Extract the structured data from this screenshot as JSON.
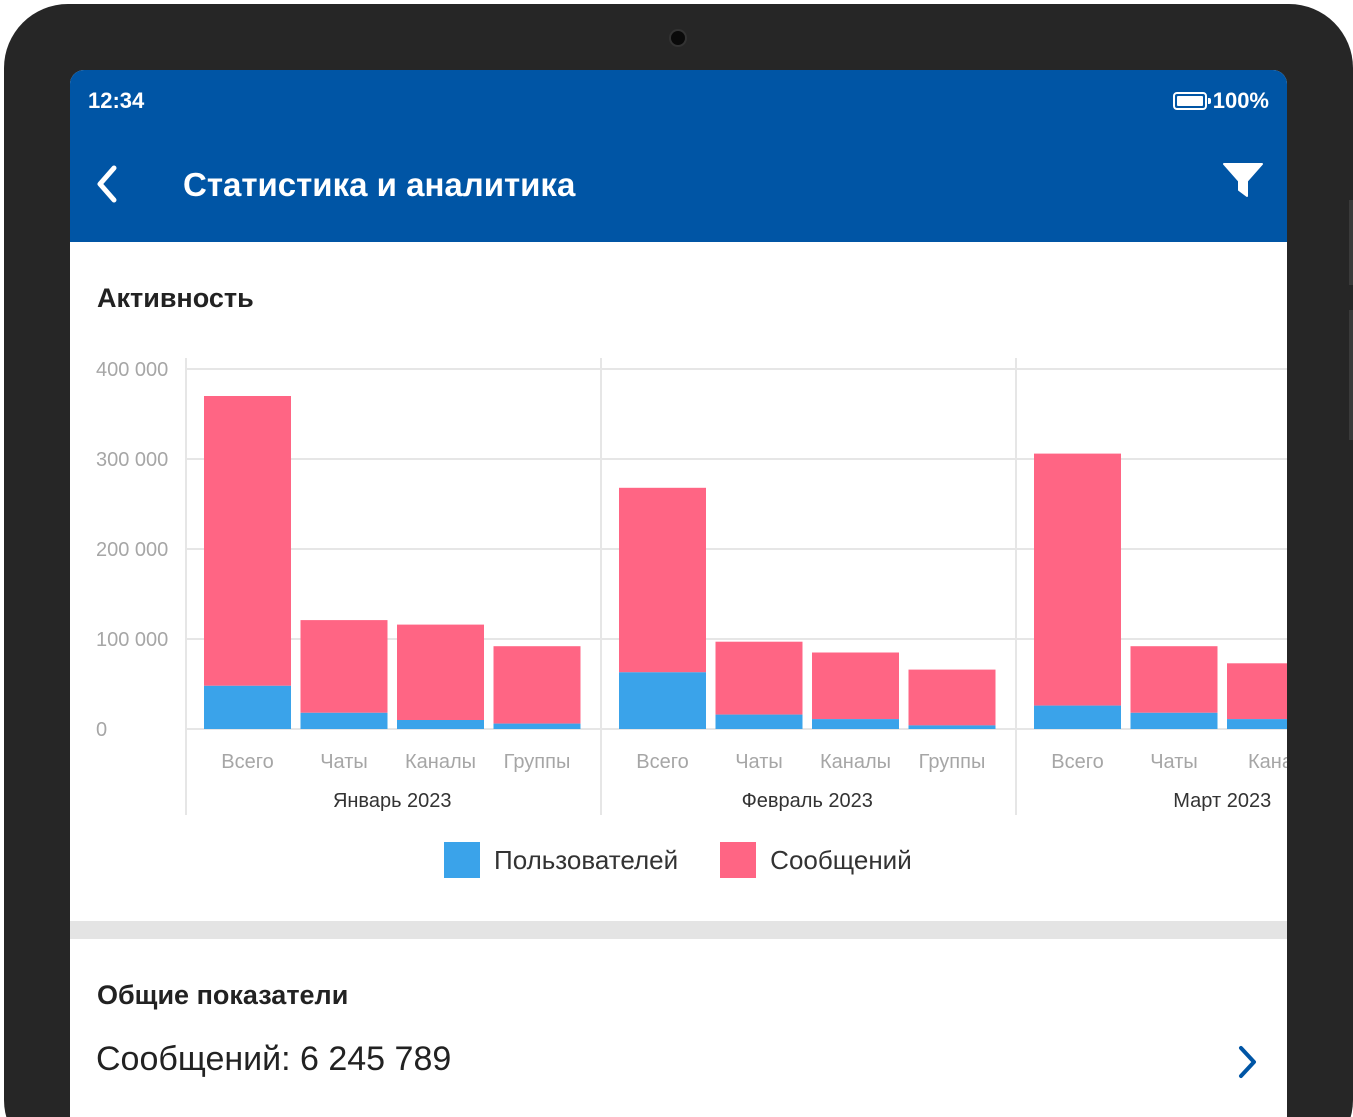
{
  "status_bar": {
    "time": "12:34",
    "battery": "100%"
  },
  "header": {
    "title": "Статистика и аналитика"
  },
  "activity": {
    "title": "Активность",
    "legend": {
      "users": "Пользователей",
      "messages": "Сообщений"
    }
  },
  "summary": {
    "title": "Общие показатели",
    "messages_label": "Сообщений: 6 245 789"
  },
  "colors": {
    "accent": "#0055a5",
    "users": "#3aa3ea",
    "messages": "#ff6584"
  },
  "icons": {
    "back": "chevron-left-icon",
    "filter": "filter-icon",
    "row": "chevron-right-icon",
    "battery": "battery-icon"
  },
  "chart_data": {
    "type": "bar",
    "stacked": true,
    "ylim": [
      0,
      400000
    ],
    "yticks": [
      0,
      100000,
      200000,
      300000,
      400000
    ],
    "ytick_labels": [
      "0",
      "100 000",
      "200 000",
      "300 000",
      "400 000"
    ],
    "grid": true,
    "legend_position": "bottom",
    "groups": [
      {
        "label": "Январь 2023",
        "categories": [
          "Всего",
          "Чаты",
          "Каналы",
          "Группы"
        ],
        "users": [
          48000,
          18000,
          10000,
          6000
        ],
        "messages": [
          322000,
          103000,
          106000,
          86000
        ]
      },
      {
        "label": "Февраль 2023",
        "categories": [
          "Всего",
          "Чаты",
          "Каналы",
          "Группы"
        ],
        "users": [
          63000,
          16000,
          11000,
          4000
        ],
        "messages": [
          205000,
          81000,
          74000,
          62000
        ]
      },
      {
        "label": "Март 2023",
        "categories": [
          "Всего",
          "Чаты",
          "Кана"
        ],
        "users": [
          26000,
          18000,
          11000
        ],
        "messages": [
          280000,
          74000,
          62000
        ]
      }
    ],
    "series": [
      {
        "name": "Пользователей",
        "key": "users"
      },
      {
        "name": "Сообщений",
        "key": "messages"
      }
    ]
  }
}
